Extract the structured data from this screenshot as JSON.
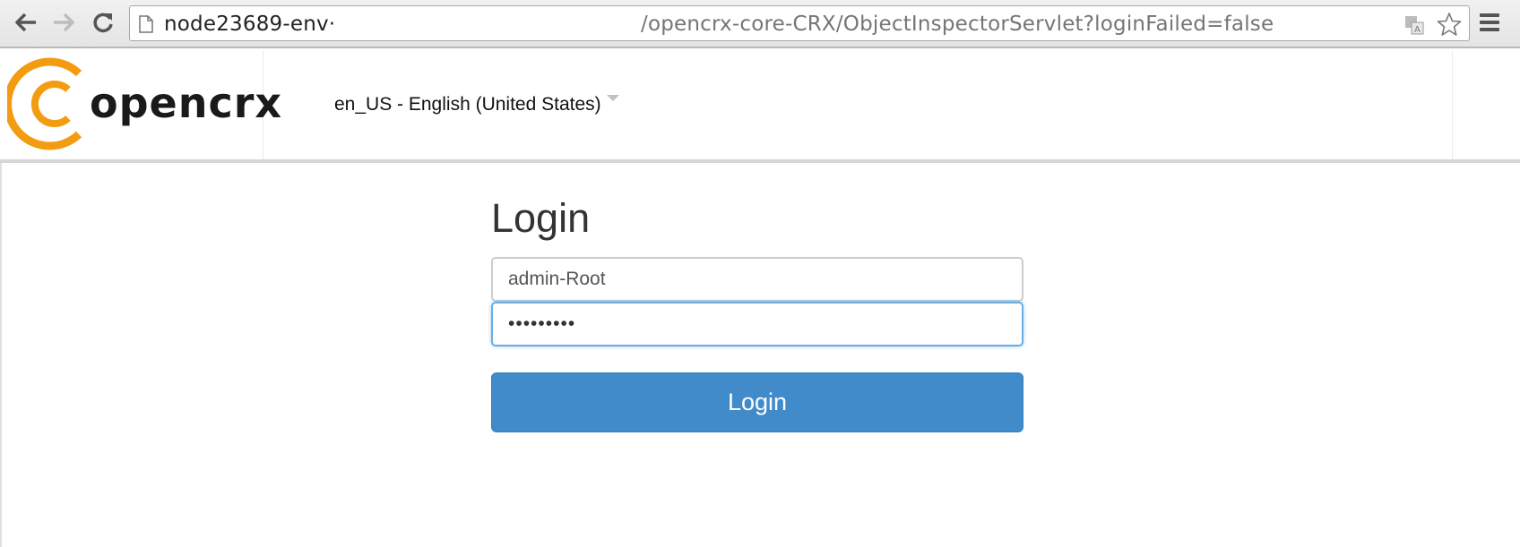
{
  "browser": {
    "url_host": "node23689-env·",
    "url_path": "/opencrx-core-CRX/ObjectInspectorServlet?loginFailed=false",
    "icons": [
      "back-icon",
      "forward-icon",
      "reload-icon",
      "page-icon",
      "translate-icon",
      "star-icon",
      "menu-icon"
    ]
  },
  "header": {
    "logo_text": "opencrx",
    "language_selected": "en_US - English (United States)",
    "logo_color": "#f39c12"
  },
  "login": {
    "title": "Login",
    "username_value": "admin-Root",
    "password_value": "•••••••••",
    "button_label": "Login",
    "button_color": "#428bca"
  }
}
